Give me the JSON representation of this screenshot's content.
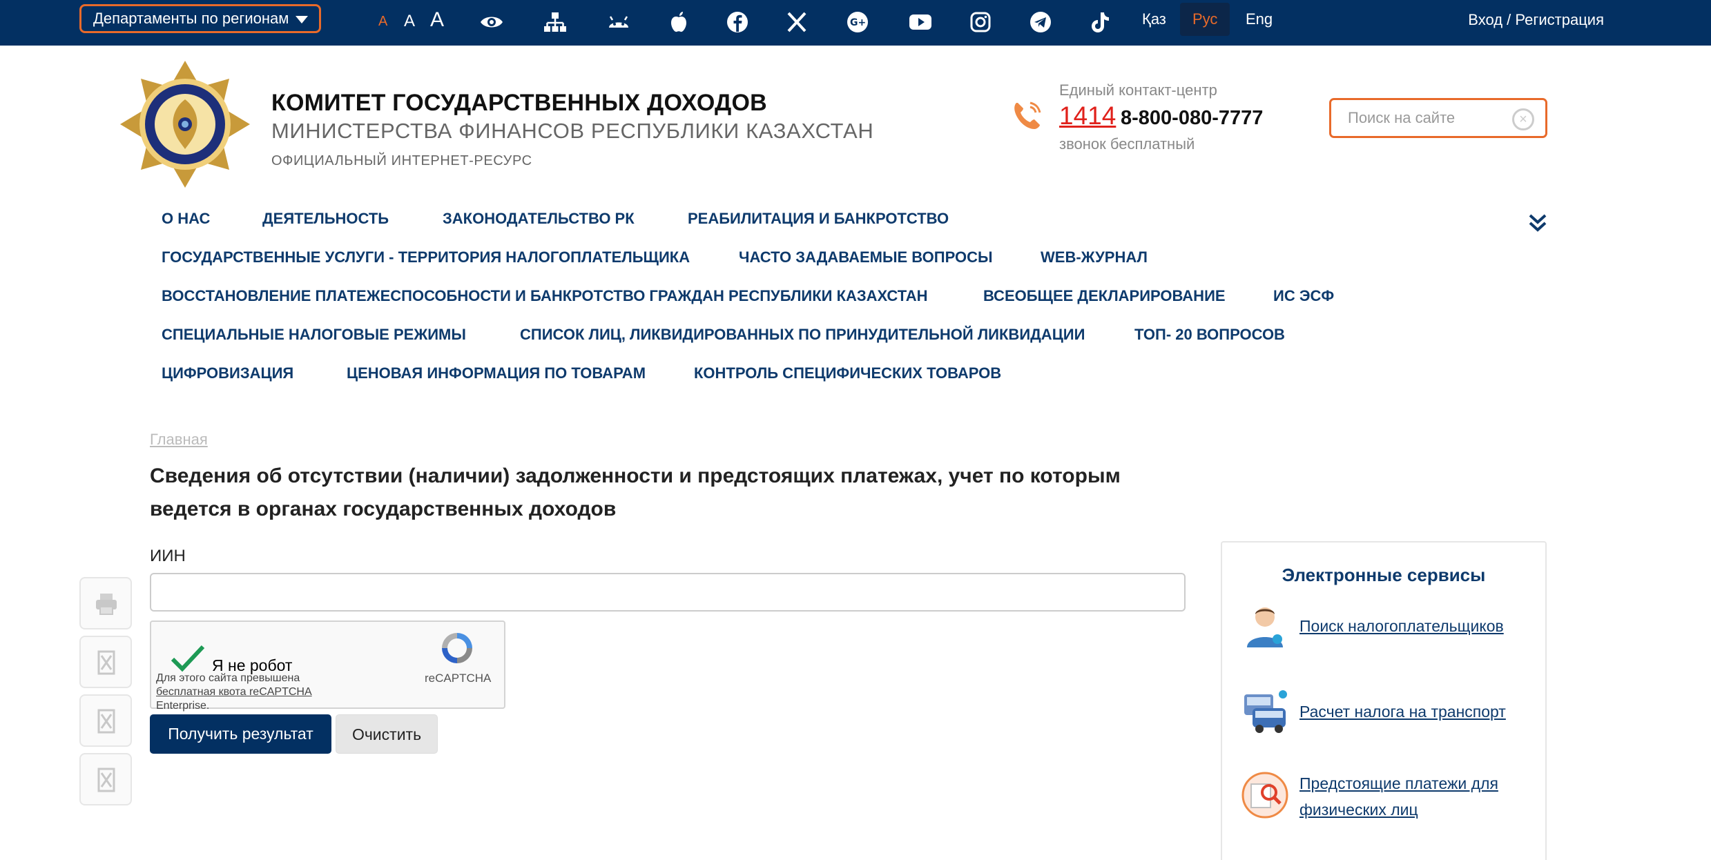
{
  "topbar": {
    "departments_label": "Департаменты по регионам",
    "font_small": "A",
    "font_medium": "A",
    "font_large": "A",
    "icons": [
      "eye-icon",
      "sitemap-icon",
      "android-icon",
      "apple-icon",
      "facebook-icon",
      "x-icon",
      "google-plus-icon",
      "youtube-icon",
      "instagram-icon",
      "telegram-icon",
      "tiktok-icon"
    ],
    "languages": [
      "Қаз",
      "Рус",
      "Eng"
    ],
    "active_language": "Рус",
    "login_label": "Вход / Регистрация"
  },
  "header": {
    "title": "КОМИТЕТ ГОСУДАРСТВЕННЫХ ДОХОДОВ",
    "subtitle": "МИНИСТЕРСТВА ФИНАНСОВ РЕСПУБЛИКИ КАЗАХСТАН",
    "resource": "ОФИЦИАЛЬНЫЙ ИНТЕРНЕТ-РЕСУРС",
    "contact_label": "Единый контакт-центр",
    "contact_short": "1414",
    "contact_phone": "8-800-080-7777",
    "contact_free": "звонок бесплатный",
    "search_placeholder": "Поиск на сайте"
  },
  "menu": {
    "rows": [
      [
        "О НАС",
        "ДЕЯТЕЛЬНОСТЬ",
        "ЗАКОНОДАТЕЛЬСТВО РК",
        "РЕАБИЛИТАЦИЯ И БАНКРОТСТВО"
      ],
      [
        "ГОСУДАРСТВЕННЫЕ УСЛУГИ - ТЕРРИТОРИЯ НАЛОГОПЛАТЕЛЬЩИКА",
        "ЧАСТО ЗАДАВАЕМЫЕ ВОПРОСЫ",
        "WEB-ЖУРНАЛ"
      ],
      [
        "ВОССТАНОВЛЕНИЕ ПЛАТЕЖЕСПОСОБНОСТИ И БАНКРОТСТВО ГРАЖДАН РЕСПУБЛИКИ КАЗАХСТАН",
        "ВСЕОБЩЕЕ ДЕКЛАРИРОВАНИЕ",
        "ИС ЭСФ"
      ],
      [
        "СПЕЦИАЛЬНЫЕ НАЛОГОВЫЕ РЕЖИМЫ",
        "СПИСОК ЛИЦ, ЛИКВИДИРОВАННЫХ ПО ПРИНУДИТЕЛЬНОЙ ЛИКВИДАЦИИ",
        "ТОП- 20 ВОПРОСОВ"
      ],
      [
        "ЦИФРОВИЗАЦИЯ",
        "ЦЕНОВАЯ ИНФОРМАЦИЯ ПО ТОВАРАМ",
        "КОНТРОЛЬ СПЕЦИФИЧЕСКИХ ТОВАРОВ"
      ]
    ]
  },
  "content": {
    "breadcrumb": "Главная",
    "title": "Сведения об отсутствии (наличии) задолженности и предстоящих платежах, учет по которым ведется в органах государственных доходов",
    "iin_label": "ИИН",
    "iin_value": "",
    "captcha": {
      "label": "Я не робот",
      "brand": "reCAPTCHA",
      "note_line1": "Для этого сайта превышена",
      "note_link": "бесплатная квота reCAPTCHA",
      "note_line3": "Enterprise."
    },
    "submit_label": "Получить результат",
    "clear_label": "Очистить"
  },
  "side_tools": [
    "printer-icon",
    "document-icon",
    "document-icon",
    "document-icon"
  ],
  "eservices": {
    "title": "Электронные сервисы",
    "items": [
      {
        "label": "Поиск налогоплательщиков",
        "icon": "person-search-icon"
      },
      {
        "label": "Расчет налога на транспорт",
        "icon": "vehicles-icon"
      },
      {
        "label": "Предстоящие платежи для физических лиц",
        "icon": "payment-search-icon"
      }
    ]
  },
  "colors": {
    "topbar_bg": "#033062",
    "accent_orange": "#e86a2a",
    "menu_text": "#0e3a6c",
    "hotline_red": "#e0211b"
  }
}
